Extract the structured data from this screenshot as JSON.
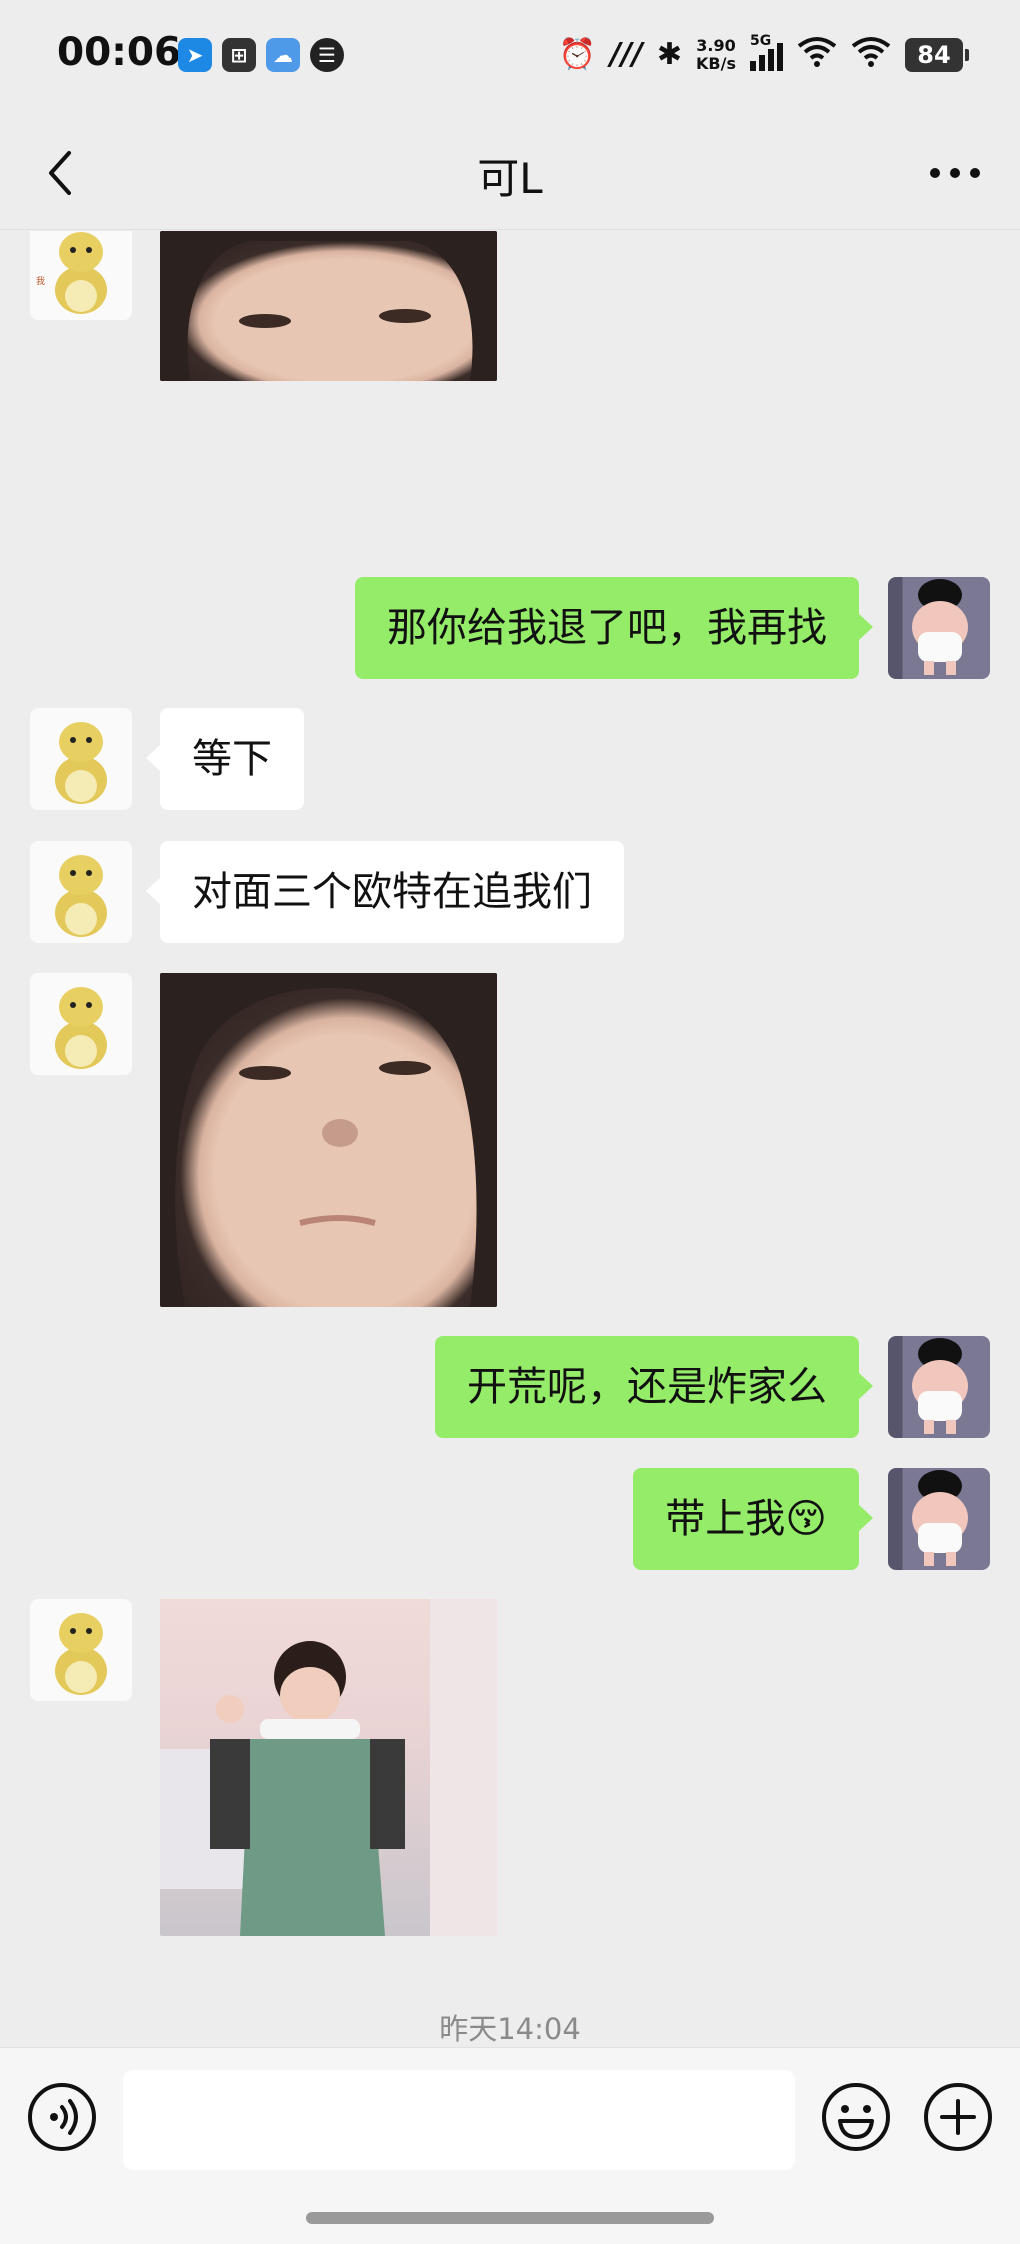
{
  "status_bar": {
    "time": "00:06",
    "net_speed_value": "3.90",
    "net_speed_unit": "KB/s",
    "network_type": "5G",
    "battery_level": "84"
  },
  "header": {
    "title": "可L"
  },
  "messages": [
    {
      "sender": "them",
      "type": "image",
      "description_icon": "sticker-toddler-face"
    },
    {
      "sender": "me",
      "type": "text",
      "text": "那你给我退了吧，我再找"
    },
    {
      "sender": "them",
      "type": "text",
      "text": "等下"
    },
    {
      "sender": "them",
      "type": "text",
      "text": "对面三个欧特在追我们"
    },
    {
      "sender": "them",
      "type": "image",
      "description_icon": "sticker-toddler-face"
    },
    {
      "sender": "me",
      "type": "text",
      "text": "开荒呢，还是炸家么"
    },
    {
      "sender": "me",
      "type": "text",
      "text": "带上我",
      "emoji": "😚"
    },
    {
      "sender": "them",
      "type": "image",
      "description_icon": "sticker-toddler-waving"
    }
  ],
  "timestamp": "昨天14:04",
  "input": {
    "value": "",
    "placeholder": ""
  },
  "icons": {
    "back": "chevron-left-icon",
    "more": "more-dots-icon",
    "voice": "voice-icon",
    "emoji": "emoji-icon",
    "plus": "plus-icon"
  },
  "colors": {
    "my_bubble": "#95ec69",
    "their_bubble": "#ffffff",
    "background": "#ededed"
  }
}
